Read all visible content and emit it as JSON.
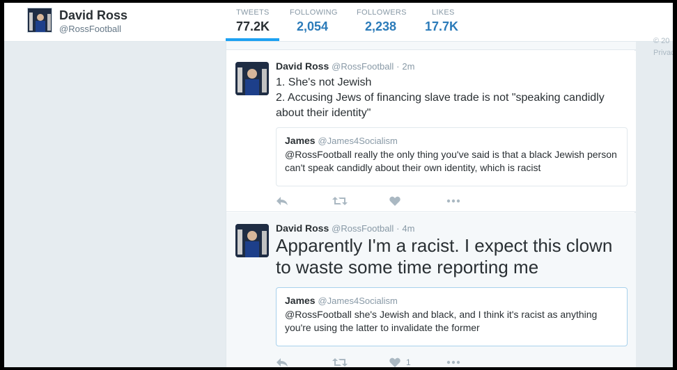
{
  "profile": {
    "name": "David Ross",
    "handle": "@RossFootball"
  },
  "stats": [
    {
      "label": "TWEETS",
      "value": "77.2K",
      "active": true
    },
    {
      "label": "FOLLOWING",
      "value": "2,054",
      "active": false
    },
    {
      "label": "FOLLOWERS",
      "value": "2,238",
      "active": false
    },
    {
      "label": "LIKES",
      "value": "17.7K",
      "active": false
    }
  ],
  "side": {
    "copyright": "© 20",
    "privacy": "Privac"
  },
  "tweets": [
    {
      "name": "David Ross",
      "handle": "@RossFootball",
      "dot": "·",
      "time": "2m",
      "lines": [
        "1. She's not Jewish",
        "2. Accusing Jews of financing slave trade is not \"speaking candidly",
        "about their identity\""
      ],
      "quote": {
        "name": "James",
        "handle": "@James4Socialism",
        "lines": [
          "@RossFootball really the only thing you've said is that a black Jewish person",
          "can't speak candidly about their own identity, which is racist"
        ]
      },
      "like_count": ""
    },
    {
      "name": "David Ross",
      "handle": "@RossFootball",
      "dot": "·",
      "time": "4m",
      "lines": [
        "Apparently I'm a racist. I expect this clown",
        "to waste some time reporting me"
      ],
      "quote": {
        "name": "James",
        "handle": "@James4Socialism",
        "lines": [
          "@RossFootball she's Jewish and black, and I think it's racist as anything",
          "you're using the latter to invalidate the former"
        ]
      },
      "like_count": "1"
    }
  ],
  "icons": {
    "reply": "reply-icon",
    "retweet": "retweet-icon",
    "like": "heart-icon",
    "more": "more-icon"
  },
  "colors": {
    "link": "#2b7bb9",
    "accent": "#1da1f2",
    "muted": "#8899a6",
    "text": "#292f33",
    "background": "#e6ecf0"
  }
}
